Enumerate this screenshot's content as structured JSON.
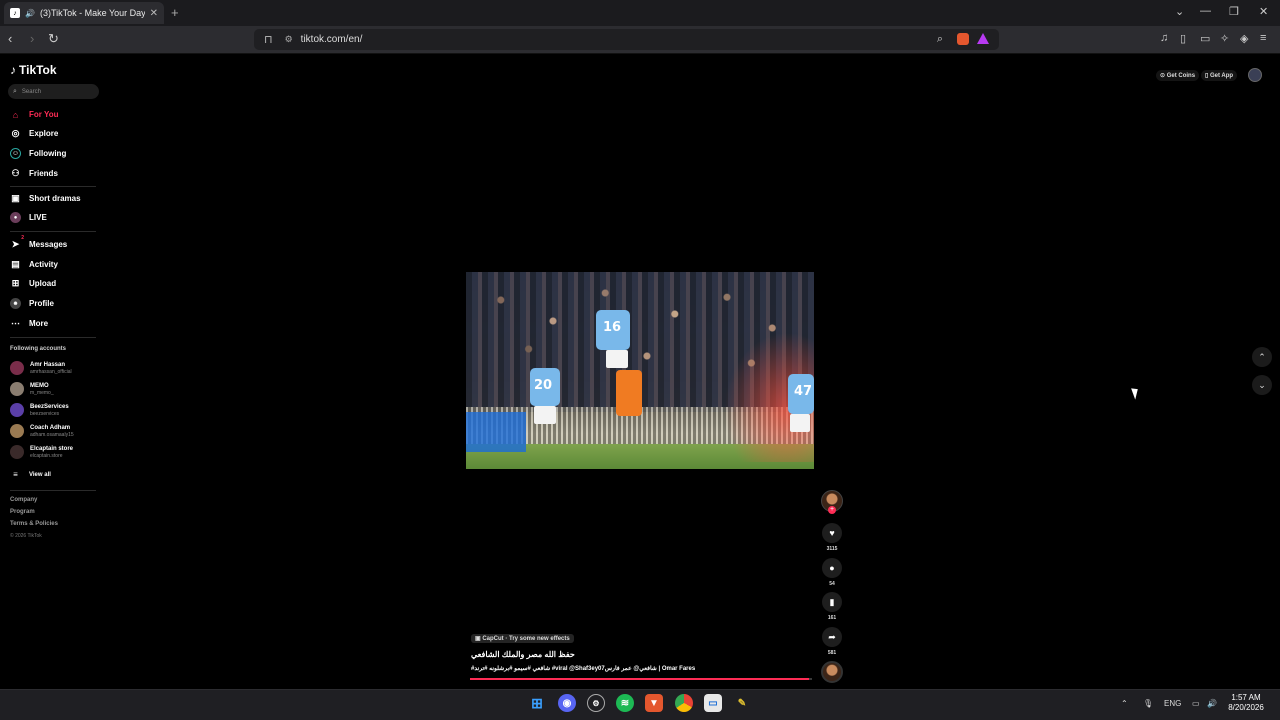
{
  "browser": {
    "tab_badge": "♪",
    "tab_title": "(3)TikTok - Make Your Day",
    "url": "tiktok.com/en/"
  },
  "tiktok": {
    "logo": "TikTok",
    "search_placeholder": "Search",
    "nav": [
      {
        "label": "For You",
        "icon": "home-icon"
      },
      {
        "label": "Explore",
        "icon": "compass-icon"
      },
      {
        "label": "Following",
        "icon": "following-icon"
      },
      {
        "label": "Friends",
        "icon": "friends-icon"
      },
      {
        "label": "Short dramas",
        "icon": "drama-icon"
      },
      {
        "label": "LIVE",
        "icon": "live-icon"
      },
      {
        "label": "Messages",
        "icon": "message-icon"
      },
      {
        "label": "Activity",
        "icon": "activity-icon"
      },
      {
        "label": "Upload",
        "icon": "upload-icon"
      },
      {
        "label": "Profile",
        "icon": "profile-icon"
      },
      {
        "label": "More",
        "icon": "more-icon"
      }
    ],
    "messages_badge": "2",
    "following_title": "Following accounts",
    "accounts": [
      {
        "name": "Amr Hassan",
        "handle": "amrhassan_official"
      },
      {
        "name": "MEMO",
        "handle": "m_memo_"
      },
      {
        "name": "BeezServices",
        "handle": "beezservices"
      },
      {
        "name": "Coach Adham",
        "handle": "adham.osamaaly15"
      },
      {
        "name": "Elcaptain store",
        "handle": "elcaptain.store"
      }
    ],
    "view_all": "View all",
    "footer": [
      "Company",
      "Program",
      "Terms & Policies"
    ],
    "copyright": "© 2026 TikTok",
    "get_coins": "Get Coins",
    "get_app": "Get App"
  },
  "video": {
    "player_numbers": [
      "16",
      "20",
      "47"
    ],
    "likes": "3115",
    "comments": "54",
    "saves": "161",
    "shares": "581",
    "effect_tag": "CapCut · Try some new effects",
    "caption_title": "حفظ الله مصر والملك الشافعي",
    "caption_text": "#شافعي #سيمو #برشلونه #ترند #viral @Shaf3ey07شافعي@ عمر فارس | Omar Fares",
    "progress": 0.99
  },
  "taskbar": {
    "lang": "ENG",
    "time": "1:57 AM",
    "date": "8/20/2026"
  },
  "colors": {
    "accent": "#fe2c55",
    "background": "#000000"
  }
}
